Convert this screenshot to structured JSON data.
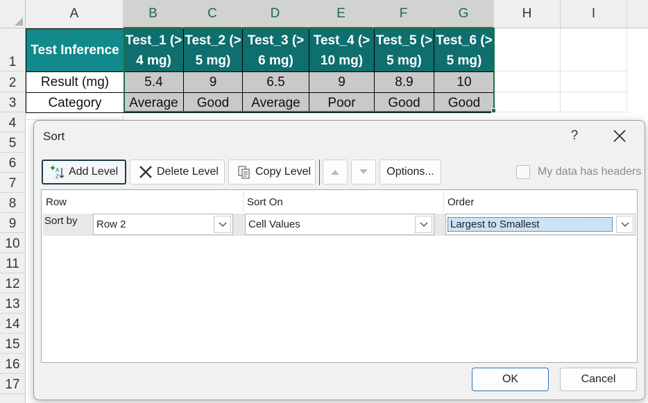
{
  "sheet": {
    "columns": [
      "A",
      "B",
      "C",
      "D",
      "E",
      "F",
      "G",
      "H",
      "I"
    ],
    "rows": [
      "1",
      "2",
      "3",
      "4",
      "5",
      "6",
      "7",
      "8",
      "9",
      "10",
      "11",
      "12",
      "13",
      "14",
      "15",
      "16",
      "17"
    ],
    "table": {
      "header": [
        "Test Inference",
        "Test_1 (> 4 mg)",
        "Test_2 (> 5 mg)",
        "Test_3 (> 6 mg)",
        "Test_4 (> 10 mg)",
        "Test_5 (> 5 mg)",
        "Test_6 (> 5 mg)"
      ],
      "rows": [
        [
          "Result (mg)",
          "5.4",
          "9",
          "6.5",
          "9",
          "8.9",
          "10"
        ],
        [
          "Category",
          "Average",
          "Good",
          "Average",
          "Poor",
          "Good",
          "Good"
        ]
      ]
    },
    "colors": {
      "header_bg": "#12898a",
      "selection": "#1e7145"
    }
  },
  "dialog": {
    "title": "Sort",
    "help": "?",
    "toolbar": {
      "add_level": "Add Level",
      "delete_level": "Delete Level",
      "copy_level": "Copy Level",
      "options": "Options..."
    },
    "my_data_has_headers": "My data has headers",
    "columns": {
      "row": "Row",
      "sort_on": "Sort On",
      "order": "Order"
    },
    "level": {
      "label": "Sort by",
      "row": "Row 2",
      "sort_on": "Cell Values",
      "order": "Largest to Smallest"
    },
    "ok": "OK",
    "cancel": "Cancel"
  }
}
